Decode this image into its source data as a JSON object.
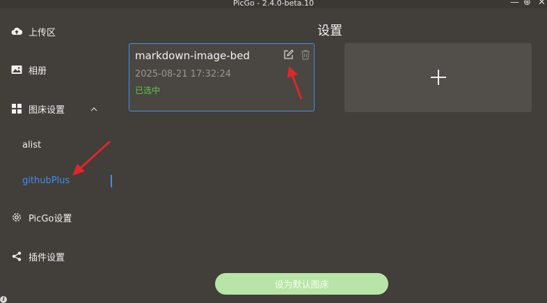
{
  "window": {
    "title": "PicGo - 2.4.0-beta.10"
  },
  "sidebar": {
    "items": [
      {
        "label": "上传区",
        "icon": "cloud-upload-icon"
      },
      {
        "label": "相册",
        "icon": "image-icon"
      },
      {
        "label": "图床设置",
        "icon": "grid-icon"
      },
      {
        "label": "PicGo设置",
        "icon": "gear-icon"
      },
      {
        "label": "插件设置",
        "icon": "share-icon"
      }
    ],
    "subitems": [
      {
        "label": "alist"
      },
      {
        "label": "githubPlus",
        "active": true
      }
    ],
    "colors": {
      "active": "#3f8ef7"
    }
  },
  "main": {
    "title": "设置",
    "config_card": {
      "name": "markdown-image-bed",
      "time": "2025-08-21 17:32:24",
      "status": "已选中"
    },
    "set_default_button": "设为默认图床"
  },
  "colors": {
    "background": "#423e39",
    "accent": "#4a90e2",
    "selected": "#5fc94a",
    "button": "#b8e4a8",
    "annotation": "#e0262a"
  }
}
